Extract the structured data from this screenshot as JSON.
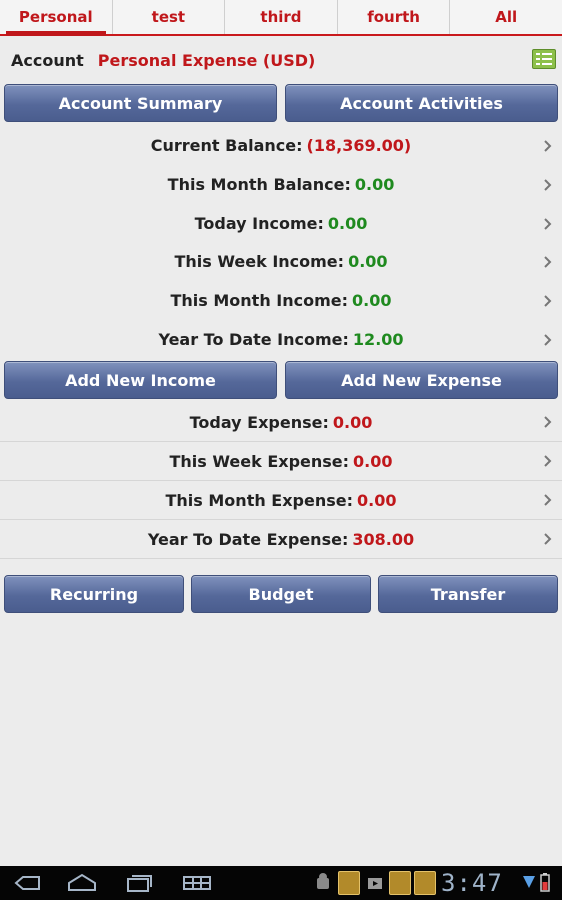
{
  "tabs": [
    {
      "label": "Personal",
      "active": true
    },
    {
      "label": "test",
      "active": false
    },
    {
      "label": "third",
      "active": false
    },
    {
      "label": "fourth",
      "active": false
    },
    {
      "label": "All",
      "active": false
    }
  ],
  "account": {
    "label": "Account",
    "value": "Personal Expense (USD)",
    "icon": "list-view-icon"
  },
  "top_buttons": {
    "summary": "Account Summary",
    "activities": "Account Activities"
  },
  "income_rows": [
    {
      "label": "Current Balance:",
      "value": "(18,369.00)",
      "tone": "negative"
    },
    {
      "label": "This Month Balance:",
      "value": "0.00",
      "tone": "positive"
    },
    {
      "label": "Today Income:",
      "value": "0.00",
      "tone": "positive"
    },
    {
      "label": "This Week Income:",
      "value": "0.00",
      "tone": "positive"
    },
    {
      "label": "This Month Income:",
      "value": "0.00",
      "tone": "positive"
    },
    {
      "label": "Year To Date Income:",
      "value": "12.00",
      "tone": "positive"
    }
  ],
  "add_buttons": {
    "income": "Add New Income",
    "expense": "Add New Expense"
  },
  "expense_rows": [
    {
      "label": "Today Expense:",
      "value": "0.00",
      "tone": "negative"
    },
    {
      "label": "This Week Expense:",
      "value": "0.00",
      "tone": "negative"
    },
    {
      "label": "This Month Expense:",
      "value": "0.00",
      "tone": "negative"
    },
    {
      "label": "Year To Date Expense:",
      "value": "308.00",
      "tone": "negative"
    }
  ],
  "bottom_buttons": {
    "recurring": "Recurring",
    "budget": "Budget",
    "transfer": "Transfer"
  },
  "status_bar": {
    "time": "3:47"
  },
  "colors": {
    "accent": "#c0171b",
    "positive": "#1f8a1f",
    "button": "#55689a"
  }
}
